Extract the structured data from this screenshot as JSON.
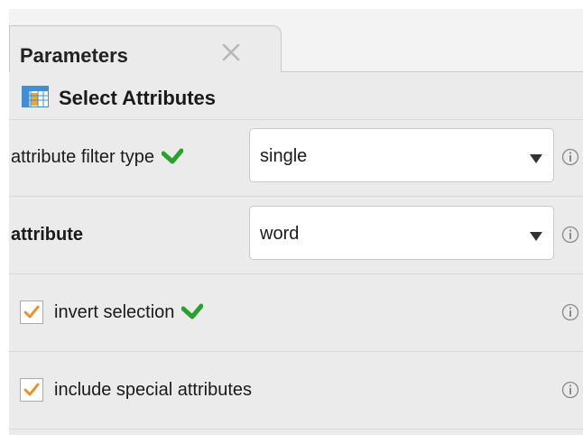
{
  "tab": {
    "title": "Parameters",
    "close_icon": "close-icon"
  },
  "section": {
    "title": "Select Attributes",
    "icon": "table-icon"
  },
  "params": {
    "filter_type": {
      "label": "attribute filter type",
      "value": "single",
      "status_icon": "check-icon"
    },
    "attribute": {
      "label": "attribute",
      "value": "word"
    },
    "invert_selection": {
      "label": "invert selection",
      "checked": true,
      "status_icon": "check-icon"
    },
    "include_special": {
      "label": "include special attributes",
      "checked": true
    }
  },
  "colors": {
    "check_green": "#27a22b",
    "checkbox_orange": "#f28c1c",
    "table_blue": "#3e8fd6",
    "table_orange": "#f5a623"
  }
}
